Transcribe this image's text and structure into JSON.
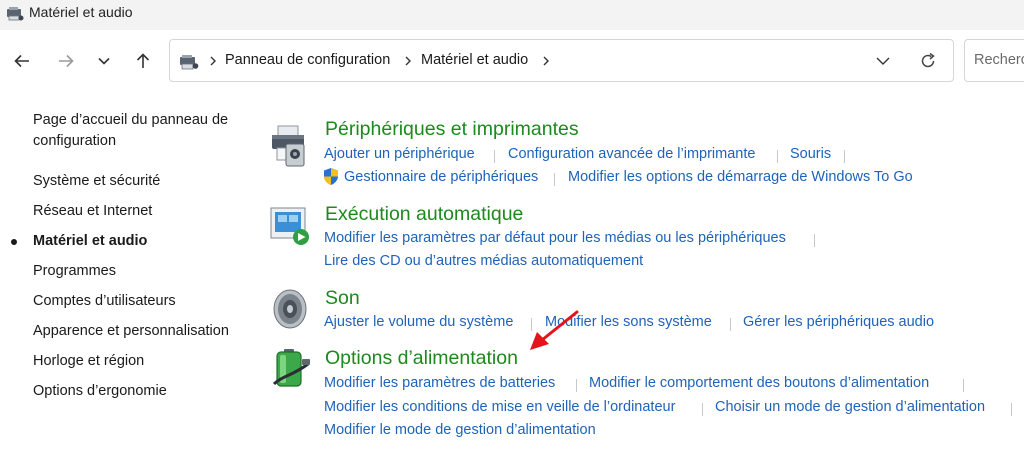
{
  "window": {
    "title": "Matériel et audio"
  },
  "addressbar": {
    "crumbs": [
      "Panneau de configuration",
      "Matériel et audio"
    ],
    "search_placeholder": "Rechercher"
  },
  "sidebar": {
    "home": "Page d’accueil du panneau de configuration",
    "items": [
      {
        "label": "Système et sécurité",
        "active": false
      },
      {
        "label": "Réseau et Internet",
        "active": false
      },
      {
        "label": "Matériel et audio",
        "active": true
      },
      {
        "label": "Programmes",
        "active": false
      },
      {
        "label": "Comptes d’utilisateurs",
        "active": false
      },
      {
        "label": "Apparence et personnalisation",
        "active": false
      },
      {
        "label": "Horloge et région",
        "active": false
      },
      {
        "label": "Options d’ergonomie",
        "active": false
      }
    ]
  },
  "categories": [
    {
      "title": "Périphériques et imprimantes",
      "icon": "printer-icon",
      "links": [
        "Ajouter un périphérique",
        "Configuration avancée de l’imprimante",
        "Souris",
        "Gestionnaire de périphériques",
        "Modifier les options de démarrage de Windows To Go"
      ]
    },
    {
      "title": "Exécution automatique",
      "icon": "autoplay-icon",
      "links": [
        "Modifier les paramètres par défaut pour les médias ou les périphériques",
        "Lire des CD ou d’autres médias automatiquement"
      ]
    },
    {
      "title": "Son",
      "icon": "speaker-icon",
      "links": [
        "Ajuster le volume du système",
        "Modifier les sons système",
        "Gérer les périphériques audio"
      ]
    },
    {
      "title": "Options d’alimentation",
      "icon": "battery-icon",
      "links": [
        "Modifier les paramètres de batteries",
        "Modifier le comportement des boutons d’alimentation",
        "Modifier les conditions de mise en veille de l’ordinateur",
        "Choisir un mode de gestion d’alimentation",
        "Modifier le mode de gestion d’alimentation"
      ]
    }
  ],
  "colors": {
    "link": "#1e63b8",
    "category_title": "#1c8a1c",
    "annotation_arrow": "#e3141b"
  }
}
